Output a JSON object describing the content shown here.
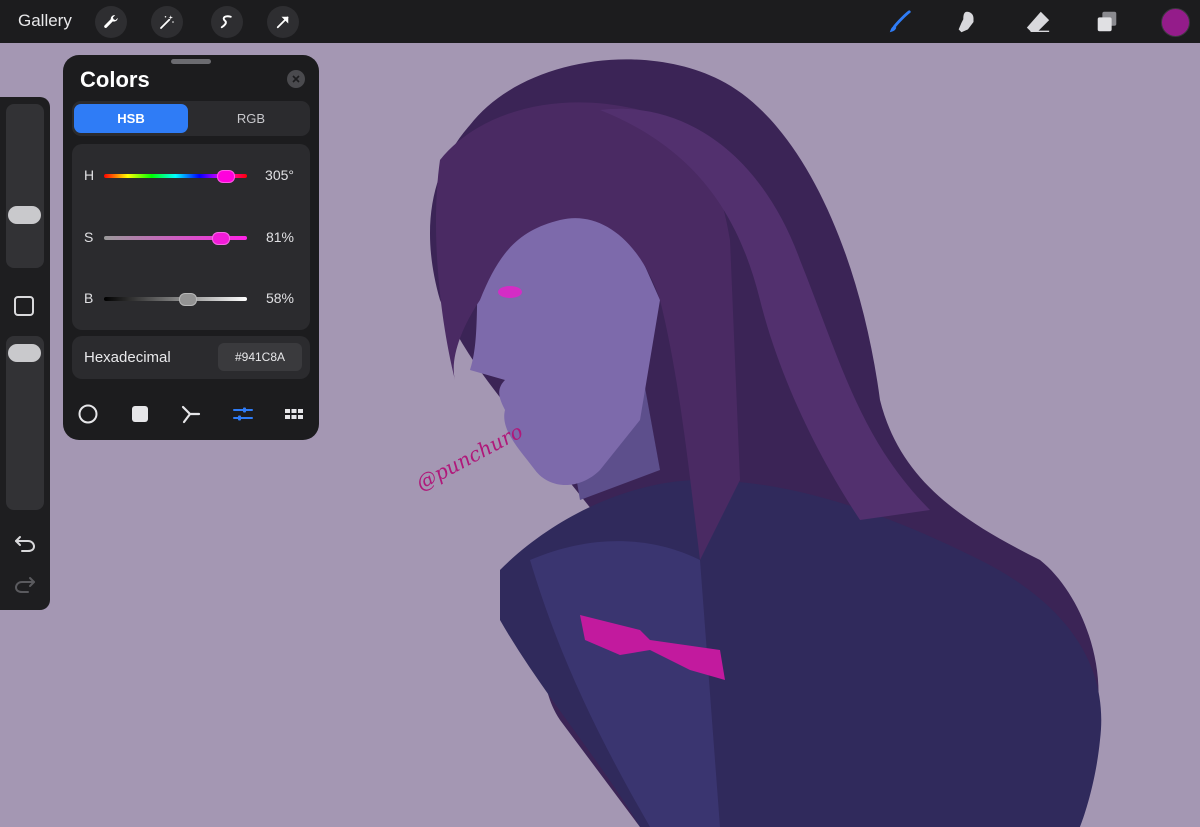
{
  "topbar": {
    "gallery_label": "Gallery",
    "left_tools": [
      "wrench-icon",
      "magic-wand-icon",
      "selection-icon",
      "transform-arrow-icon"
    ],
    "right_tools": [
      "brush-icon",
      "smudge-icon",
      "eraser-icon",
      "layers-icon"
    ],
    "current_color": "#941C8A",
    "active_tool_color": "#2f7cf6"
  },
  "sidebar": {
    "controls": [
      "brush-size-slider",
      "modify-button",
      "opacity-slider",
      "undo-icon",
      "redo-icon"
    ]
  },
  "colors_panel": {
    "title": "Colors",
    "tabs": [
      {
        "label": "HSB",
        "active": true
      },
      {
        "label": "RGB",
        "active": false
      }
    ],
    "sliders": [
      {
        "label": "H",
        "value": "305°",
        "fraction": 0.847
      },
      {
        "label": "S",
        "value": "81%",
        "fraction": 0.81
      },
      {
        "label": "B",
        "value": "58%",
        "fraction": 0.58
      }
    ],
    "hex_label": "Hexadecimal",
    "hex_value": "#941C8A",
    "modes": [
      {
        "icon": "disc-mode-icon",
        "active": false
      },
      {
        "icon": "classic-mode-icon",
        "active": false
      },
      {
        "icon": "harmony-mode-icon",
        "active": false
      },
      {
        "icon": "value-mode-icon",
        "active": true
      },
      {
        "icon": "palettes-mode-icon",
        "active": false
      }
    ]
  },
  "canvas": {
    "background_color": "#a497b3",
    "watermark": "@punchuro"
  }
}
